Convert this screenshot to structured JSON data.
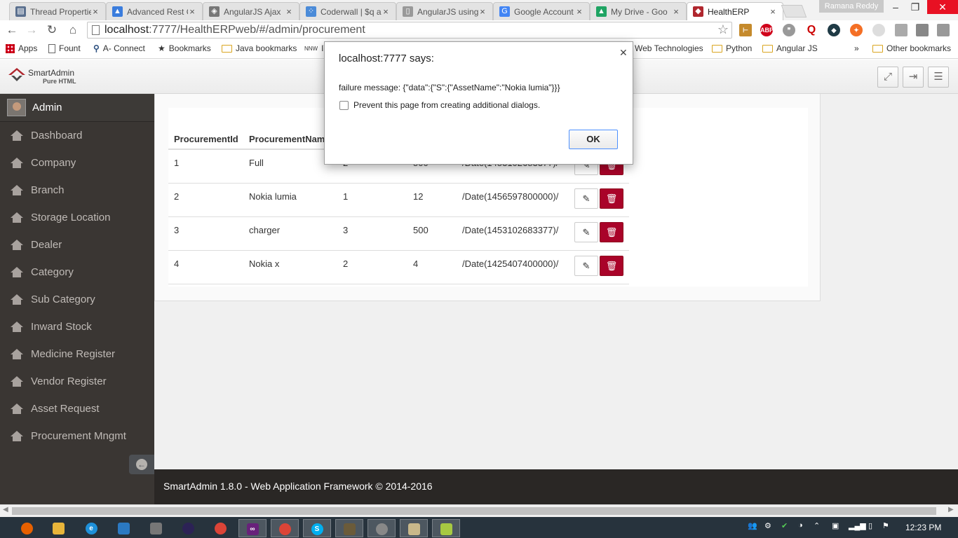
{
  "browser": {
    "tabs": [
      {
        "title": "Thread Propertie",
        "icon": "page-icon"
      },
      {
        "title": "Advanced Rest C",
        "icon": "rest-client-icon"
      },
      {
        "title": "AngularJS Ajax",
        "icon": "diamond-icon"
      },
      {
        "title": "Coderwall | $q a",
        "icon": "coderwall-icon"
      },
      {
        "title": "AngularJS using",
        "icon": "page-icon"
      },
      {
        "title": "Google Account",
        "icon": "google-icon"
      },
      {
        "title": "My Drive - Goo",
        "icon": "drive-icon"
      },
      {
        "title": "HealthERP",
        "icon": "smartadmin-icon",
        "active": true
      }
    ],
    "profile_name": "Ramana Reddy",
    "url_host": "localhost",
    "url_rest": ":7777/HealthERPweb/#/admin/procurement",
    "bookmarks": [
      {
        "label": "Apps"
      },
      {
        "label": "Fount"
      },
      {
        "label": "A- Connect"
      },
      {
        "label": "Bookmarks"
      },
      {
        "label": "Java bookmarks"
      },
      {
        "label": "IT"
      },
      {
        "label": "Web Technologies"
      },
      {
        "label": "Python"
      },
      {
        "label": "Angular JS"
      },
      {
        "label": "»"
      },
      {
        "label": "Other bookmarks"
      }
    ]
  },
  "app": {
    "logo_name": "SmartAdmin",
    "logo_sub": "Pure HTML",
    "user": "Admin",
    "nav": [
      "Dashboard",
      "Company",
      "Branch",
      "Storage Location",
      "Dealer",
      "Category",
      "Sub Category",
      "Inward Stock",
      "Medicine Register",
      "Vendor Register",
      "Asset Request",
      "Procurement Mngmt"
    ],
    "table": {
      "headers": [
        "ProcurementId",
        "ProcurementName",
        "",
        "",
        "",
        ""
      ],
      "rows": [
        {
          "id": "1",
          "name": "Full",
          "c3": "2",
          "c4": "500",
          "date": "/Date(1453102683377)/"
        },
        {
          "id": "2",
          "name": "Nokia lumia",
          "c3": "1",
          "c4": "12",
          "date": "/Date(1456597800000)/"
        },
        {
          "id": "3",
          "name": "charger",
          "c3": "3",
          "c4": "500",
          "date": "/Date(1453102683377)/"
        },
        {
          "id": "4",
          "name": "Nokia x",
          "c3": "2",
          "c4": "4",
          "date": "/Date(1425407400000)/"
        }
      ]
    },
    "footer": "SmartAdmin 1.8.0 - Web Application Framework © 2014-2016"
  },
  "dialog": {
    "title": "localhost:7777 says:",
    "message": "failure message: {\"data\":{\"S\":{\"AssetName\":\"Nokia lumia\"}}}",
    "checkbox_label": "Prevent this page from creating additional dialogs.",
    "ok_label": "OK"
  },
  "taskbar": {
    "clock": "12:23 PM"
  },
  "colors": {
    "sidebar_bg": "#3a3633",
    "footer_bg": "#2a2725",
    "delete_red": "#a90329",
    "taskbar_bg": "#27333d"
  }
}
